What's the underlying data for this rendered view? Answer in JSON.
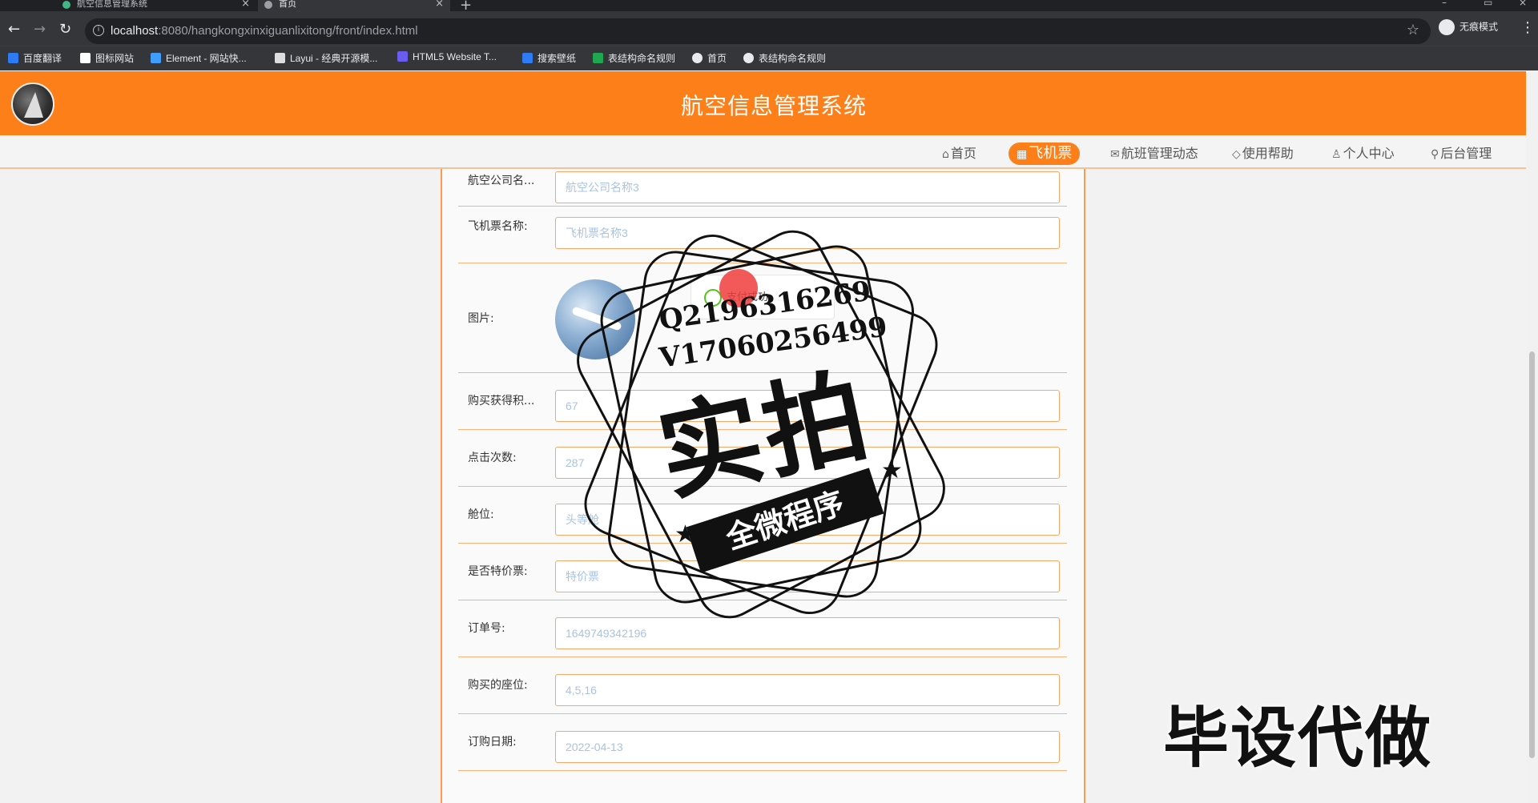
{
  "browser": {
    "tabs": [
      {
        "title": "航空信息管理系统",
        "active": false
      },
      {
        "title": "首页",
        "active": true
      }
    ],
    "url_host": "localhost",
    "url_rest": ":8080/hangkongxinxiguanlixitong/front/index.html",
    "profile_label": "无痕模式",
    "bookmarks": [
      {
        "label": "百度翻译",
        "color": "#2f7bf5"
      },
      {
        "label": "图标网站",
        "color": "#ffffff"
      },
      {
        "label": "Element - 网站快...",
        "color": "#409eff"
      },
      {
        "label": "Layui - 经典开源模...",
        "color": "#dddddd"
      },
      {
        "label": "HTML5 Website T...",
        "color": "#6b5cf0"
      },
      {
        "label": "搜索壁纸",
        "color": "#2f7bf5"
      },
      {
        "label": "表结构命名规则",
        "color": "#1fa84f"
      },
      {
        "label": "首页",
        "color": "#e8eaed"
      },
      {
        "label": "表结构命名规则",
        "color": "#e8eaed"
      }
    ]
  },
  "site": {
    "title": "航空信息管理系统",
    "accent": "#fd7f1a",
    "nav": [
      {
        "label": "首页",
        "icon": "home-icon",
        "glyph": "⌂",
        "active": false
      },
      {
        "label": "飞机票",
        "icon": "ticket-icon",
        "glyph": "▦",
        "active": true
      },
      {
        "label": "航班管理动态",
        "icon": "mail-icon",
        "glyph": "✉",
        "active": false
      },
      {
        "label": "使用帮助",
        "icon": "tag-icon",
        "glyph": "◇",
        "active": false
      },
      {
        "label": "个人中心",
        "icon": "user-icon",
        "glyph": "♙",
        "active": false
      },
      {
        "label": "后台管理",
        "icon": "link-icon",
        "glyph": "⚲",
        "active": false
      }
    ]
  },
  "form": {
    "fields": [
      {
        "label": "航空公司名...",
        "value": "航空公司名称3",
        "type": "text"
      },
      {
        "label": "飞机票名称:",
        "value": "飞机票名称3",
        "type": "text"
      },
      {
        "label": "图片:",
        "value": "",
        "type": "image"
      },
      {
        "label": "购买获得积...",
        "value": "67",
        "type": "text"
      },
      {
        "label": "点击次数:",
        "value": "287",
        "type": "text"
      },
      {
        "label": "舱位:",
        "value": "头等舱",
        "type": "text"
      },
      {
        "label": "是否特价票:",
        "value": "特价票",
        "type": "text"
      },
      {
        "label": "订单号:",
        "value": "1649749342196",
        "type": "text"
      },
      {
        "label": "购买的座位:",
        "value": "4,5,16",
        "type": "text"
      },
      {
        "label": "订购日期:",
        "value": "2022-04-13",
        "type": "text"
      }
    ]
  },
  "toast": {
    "text": "支付成功"
  },
  "watermark": {
    "line1": "Q2196316269",
    "line2": "V17060256499",
    "big": "实拍",
    "ribbon": "全微程序",
    "corner": "毕设代做"
  }
}
